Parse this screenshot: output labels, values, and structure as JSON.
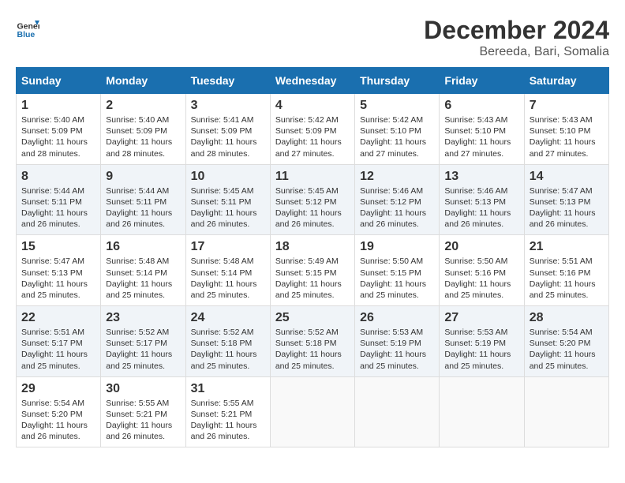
{
  "logo": {
    "line1": "General",
    "line2": "Blue"
  },
  "title": "December 2024",
  "location": "Bereeda, Bari, Somalia",
  "weekdays": [
    "Sunday",
    "Monday",
    "Tuesday",
    "Wednesday",
    "Thursday",
    "Friday",
    "Saturday"
  ],
  "weeks": [
    [
      {
        "day": "1",
        "rise": "5:40 AM",
        "set": "5:09 PM",
        "hours": "11 hours and 28 minutes."
      },
      {
        "day": "2",
        "rise": "5:40 AM",
        "set": "5:09 PM",
        "hours": "11 hours and 28 minutes."
      },
      {
        "day": "3",
        "rise": "5:41 AM",
        "set": "5:09 PM",
        "hours": "11 hours and 28 minutes."
      },
      {
        "day": "4",
        "rise": "5:42 AM",
        "set": "5:09 PM",
        "hours": "11 hours and 27 minutes."
      },
      {
        "day": "5",
        "rise": "5:42 AM",
        "set": "5:10 PM",
        "hours": "11 hours and 27 minutes."
      },
      {
        "day": "6",
        "rise": "5:43 AM",
        "set": "5:10 PM",
        "hours": "11 hours and 27 minutes."
      },
      {
        "day": "7",
        "rise": "5:43 AM",
        "set": "5:10 PM",
        "hours": "11 hours and 27 minutes."
      }
    ],
    [
      {
        "day": "8",
        "rise": "5:44 AM",
        "set": "5:11 PM",
        "hours": "11 hours and 26 minutes."
      },
      {
        "day": "9",
        "rise": "5:44 AM",
        "set": "5:11 PM",
        "hours": "11 hours and 26 minutes."
      },
      {
        "day": "10",
        "rise": "5:45 AM",
        "set": "5:11 PM",
        "hours": "11 hours and 26 minutes."
      },
      {
        "day": "11",
        "rise": "5:45 AM",
        "set": "5:12 PM",
        "hours": "11 hours and 26 minutes."
      },
      {
        "day": "12",
        "rise": "5:46 AM",
        "set": "5:12 PM",
        "hours": "11 hours and 26 minutes."
      },
      {
        "day": "13",
        "rise": "5:46 AM",
        "set": "5:13 PM",
        "hours": "11 hours and 26 minutes."
      },
      {
        "day": "14",
        "rise": "5:47 AM",
        "set": "5:13 PM",
        "hours": "11 hours and 26 minutes."
      }
    ],
    [
      {
        "day": "15",
        "rise": "5:47 AM",
        "set": "5:13 PM",
        "hours": "11 hours and 25 minutes."
      },
      {
        "day": "16",
        "rise": "5:48 AM",
        "set": "5:14 PM",
        "hours": "11 hours and 25 minutes."
      },
      {
        "day": "17",
        "rise": "5:48 AM",
        "set": "5:14 PM",
        "hours": "11 hours and 25 minutes."
      },
      {
        "day": "18",
        "rise": "5:49 AM",
        "set": "5:15 PM",
        "hours": "11 hours and 25 minutes."
      },
      {
        "day": "19",
        "rise": "5:50 AM",
        "set": "5:15 PM",
        "hours": "11 hours and 25 minutes."
      },
      {
        "day": "20",
        "rise": "5:50 AM",
        "set": "5:16 PM",
        "hours": "11 hours and 25 minutes."
      },
      {
        "day": "21",
        "rise": "5:51 AM",
        "set": "5:16 PM",
        "hours": "11 hours and 25 minutes."
      }
    ],
    [
      {
        "day": "22",
        "rise": "5:51 AM",
        "set": "5:17 PM",
        "hours": "11 hours and 25 minutes."
      },
      {
        "day": "23",
        "rise": "5:52 AM",
        "set": "5:17 PM",
        "hours": "11 hours and 25 minutes."
      },
      {
        "day": "24",
        "rise": "5:52 AM",
        "set": "5:18 PM",
        "hours": "11 hours and 25 minutes."
      },
      {
        "day": "25",
        "rise": "5:52 AM",
        "set": "5:18 PM",
        "hours": "11 hours and 25 minutes."
      },
      {
        "day": "26",
        "rise": "5:53 AM",
        "set": "5:19 PM",
        "hours": "11 hours and 25 minutes."
      },
      {
        "day": "27",
        "rise": "5:53 AM",
        "set": "5:19 PM",
        "hours": "11 hours and 25 minutes."
      },
      {
        "day": "28",
        "rise": "5:54 AM",
        "set": "5:20 PM",
        "hours": "11 hours and 25 minutes."
      }
    ],
    [
      {
        "day": "29",
        "rise": "5:54 AM",
        "set": "5:20 PM",
        "hours": "11 hours and 26 minutes."
      },
      {
        "day": "30",
        "rise": "5:55 AM",
        "set": "5:21 PM",
        "hours": "11 hours and 26 minutes."
      },
      {
        "day": "31",
        "rise": "5:55 AM",
        "set": "5:21 PM",
        "hours": "11 hours and 26 minutes."
      },
      null,
      null,
      null,
      null
    ]
  ]
}
